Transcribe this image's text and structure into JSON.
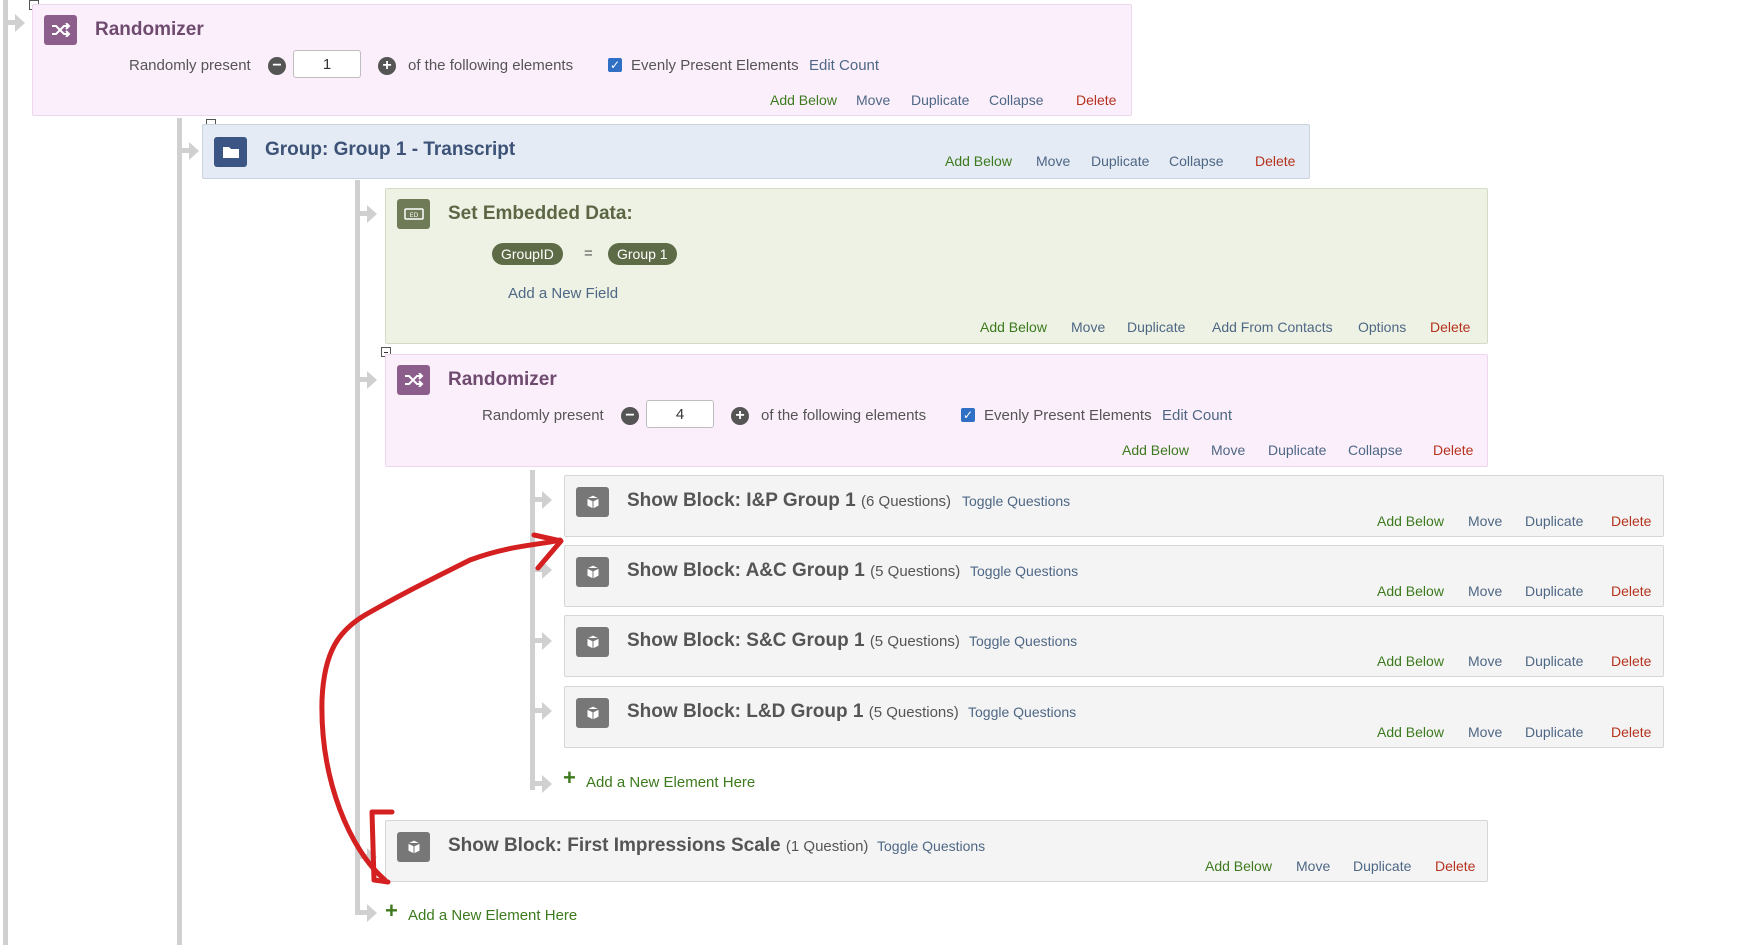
{
  "randomizer_top": {
    "title": "Randomizer",
    "present_prefix": "Randomly present",
    "count": "1",
    "present_suffix": "of the following elements",
    "evenly_label": "Evenly Present Elements",
    "edit_count": "Edit Count",
    "actions": {
      "add_below": "Add Below",
      "move": "Move",
      "duplicate": "Duplicate",
      "collapse": "Collapse",
      "delete": "Delete"
    }
  },
  "group": {
    "title": "Group: Group 1 - Transcript",
    "actions": {
      "add_below": "Add Below",
      "move": "Move",
      "duplicate": "Duplicate",
      "collapse": "Collapse",
      "delete": "Delete"
    }
  },
  "embedded_data": {
    "title": "Set Embedded Data:",
    "field_name": "GroupID",
    "equals": "=",
    "field_value": "Group 1",
    "add_field": "Add a New Field",
    "actions": {
      "add_below": "Add Below",
      "move": "Move",
      "duplicate": "Duplicate",
      "add_from_contacts": "Add From Contacts",
      "options": "Options",
      "delete": "Delete"
    }
  },
  "randomizer_inner": {
    "title": "Randomizer",
    "present_prefix": "Randomly present",
    "count": "4",
    "present_suffix": "of the following elements",
    "evenly_label": "Evenly Present Elements",
    "edit_count": "Edit Count",
    "actions": {
      "add_below": "Add Below",
      "move": "Move",
      "duplicate": "Duplicate",
      "collapse": "Collapse",
      "delete": "Delete"
    }
  },
  "blocks": [
    {
      "title": "Show Block: I&P Group 1",
      "count": "(6 Questions)",
      "toggle": "Toggle Questions"
    },
    {
      "title": "Show Block: A&C Group 1",
      "count": "(5 Questions)",
      "toggle": "Toggle Questions"
    },
    {
      "title": "Show Block: S&C Group 1",
      "count": "(5 Questions)",
      "toggle": "Toggle Questions"
    },
    {
      "title": "Show Block: L&D Group 1",
      "count": "(5 Questions)",
      "toggle": "Toggle Questions"
    }
  ],
  "block_actions": {
    "add_below": "Add Below",
    "move": "Move",
    "duplicate": "Duplicate",
    "delete": "Delete"
  },
  "add_element_inner": "Add a New Element Here",
  "first_impressions": {
    "title": "Show Block: First Impressions Scale",
    "count": "(1 Question)",
    "toggle": "Toggle Questions",
    "actions": {
      "add_below": "Add Below",
      "move": "Move",
      "duplicate": "Duplicate",
      "delete": "Delete"
    }
  },
  "add_element_outer": "Add a New Element Here",
  "colors": {
    "annotation": "#d42020",
    "add": "#3d7a1e",
    "delete": "#b5331e",
    "link": "#4e6785"
  }
}
